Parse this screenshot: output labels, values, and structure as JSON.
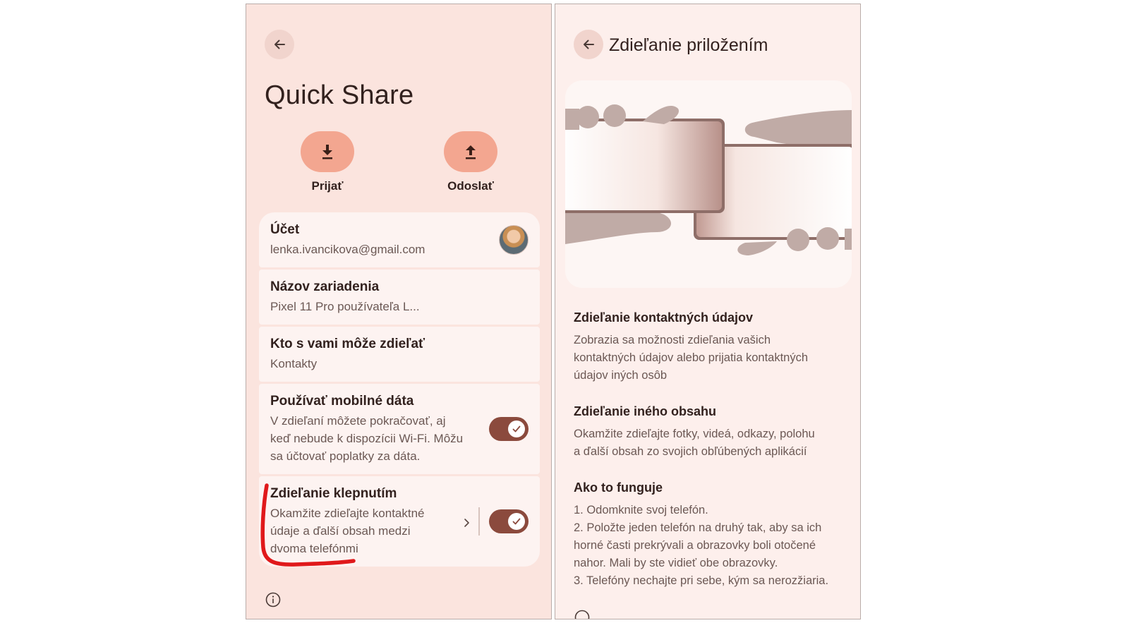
{
  "left": {
    "title": "Quick Share",
    "actions": [
      {
        "label": "Prijať",
        "icon": "download-icon"
      },
      {
        "label": "Odoslať",
        "icon": "upload-icon"
      }
    ],
    "account": {
      "title": "Účet",
      "email": "lenka.ivancikova@gmail.com"
    },
    "device_name": {
      "title": "Názov zariadenia",
      "value": "Pixel 11 Pro používateľa L..."
    },
    "who_can_share": {
      "title": "Kto s vami môže zdieľať",
      "value": "Kontakty"
    },
    "mobile_data": {
      "title": "Používať mobilné dáta",
      "lines": [
        "V zdieľaní môžete pokračovať, aj",
        "keď nebude k dispozícii Wi-Fi. Môžu",
        "sa účtovať poplatky za dáta."
      ],
      "enabled": true
    },
    "tap_share": {
      "title": "Zdieľanie klepnutím",
      "lines": [
        "Okamžite zdieľajte kontaktné",
        "údaje a ďalší obsah medzi",
        "dvoma telefónmi"
      ],
      "enabled": true
    }
  },
  "right": {
    "header": "Zdieľanie priložením",
    "sections": [
      {
        "title": "Zdieľanie kontaktných údajov",
        "lines": [
          "Zobrazia sa možnosti zdieľania vašich",
          "kontaktných údajov alebo prijatia kontaktných",
          "údajov iných osôb"
        ]
      },
      {
        "title": "Zdieľanie iného obsahu",
        "lines": [
          "Okamžite zdieľajte fotky, videá, odkazy, polohu",
          "a ďalší obsah zo svojich obľúbených aplikácií"
        ]
      },
      {
        "title": "Ako to funguje",
        "lines": [
          "1. Odomknite svoj telefón.",
          "2. Položte jeden telefón na druhý tak, aby sa ich",
          "horné časti prekrývali a obrazovky boli otočené",
          "nahor. Mali by ste vidieť obe obrazovky.",
          "3. Telefóny nechajte pri sebe, kým sa nerozžiaria."
        ]
      }
    ]
  },
  "colors": {
    "left_bg": "#fbe4de",
    "right_bg": "#fdefec",
    "card_bg": "#fdf3f1",
    "accent_button": "#f3a690",
    "toggle_on": "#8b4a3d",
    "annotation_red": "#e0191b"
  }
}
